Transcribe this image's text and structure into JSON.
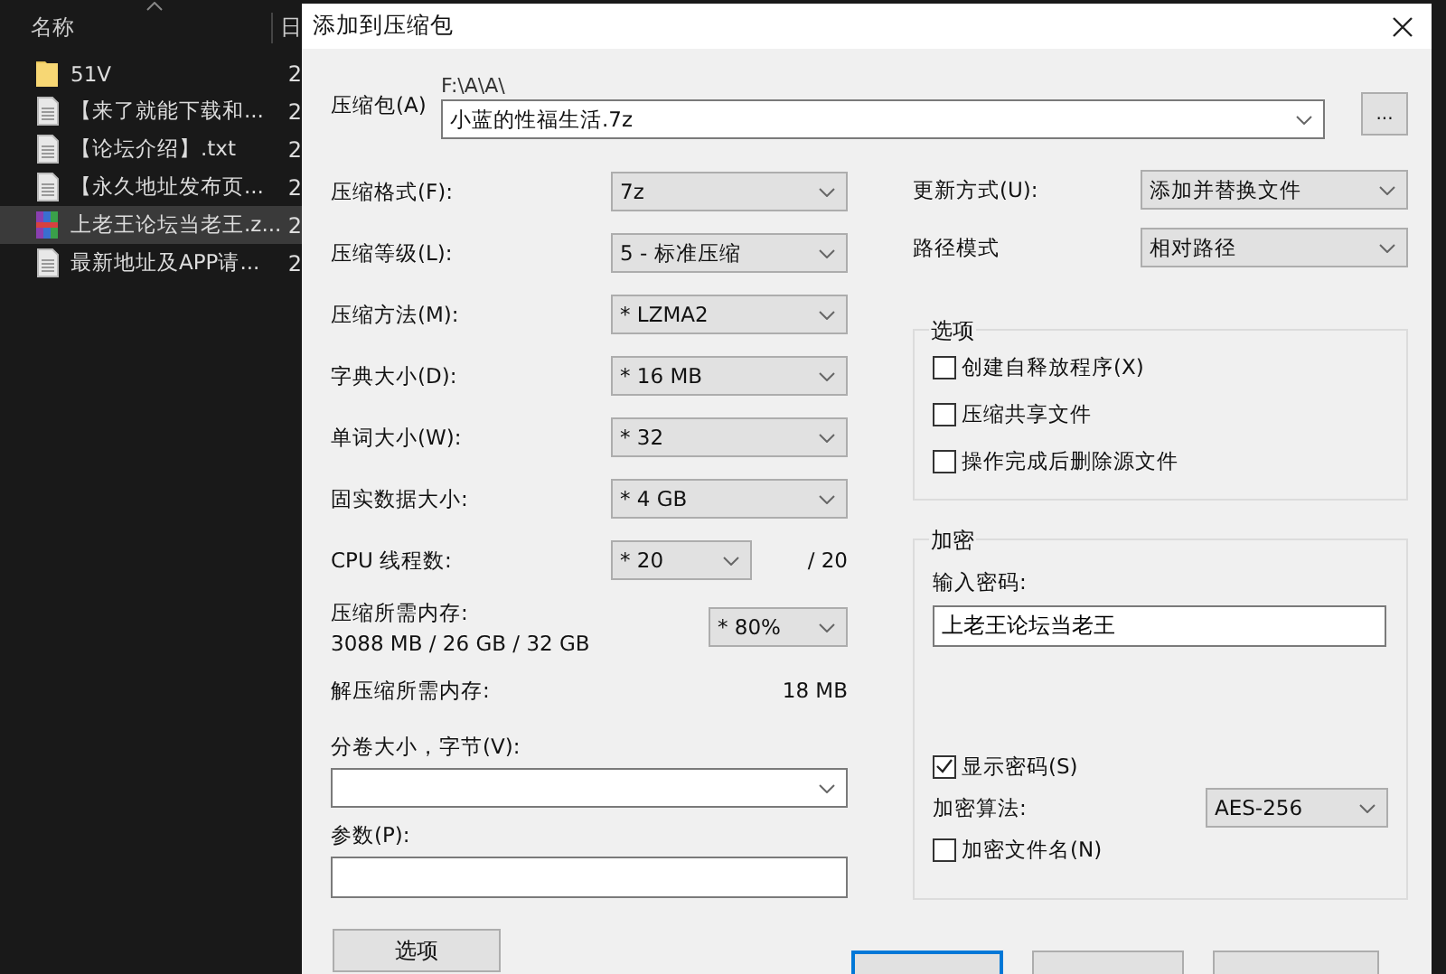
{
  "explorer": {
    "columns": [
      "名称",
      "日"
    ],
    "files": [
      {
        "name": "51V",
        "kind": "folder",
        "date": "2",
        "selected": false
      },
      {
        "name": "【来了就能下载和...",
        "kind": "text",
        "date": "2",
        "selected": false
      },
      {
        "name": "【论坛介绍】.txt",
        "kind": "text",
        "date": "2",
        "selected": false
      },
      {
        "name": "【永久地址发布页...",
        "kind": "text",
        "date": "2",
        "selected": false
      },
      {
        "name": "上老王论坛当老王.z...",
        "kind": "archive",
        "date": "2",
        "selected": true
      },
      {
        "name": "最新地址及APP请...",
        "kind": "text",
        "date": "2",
        "selected": false
      }
    ]
  },
  "dialog": {
    "title": "添加到压缩包",
    "archive": {
      "label": "压缩包(A)",
      "path": "F:\\A\\A\\",
      "value": "小蓝的性福生活.7z",
      "browse": "..."
    },
    "left_rows": [
      {
        "kind": "combo",
        "label": "压缩格式(F):",
        "value": "7z"
      },
      {
        "kind": "combo",
        "label": "压缩等级(L):",
        "value": "5 - 标准压缩"
      },
      {
        "kind": "combo",
        "label": "压缩方法(M):",
        "value": "* LZMA2"
      },
      {
        "kind": "combo",
        "label": "字典大小(D):",
        "value": "* 16 MB"
      },
      {
        "kind": "combo",
        "label": "单词大小(W):",
        "value": "* 32"
      },
      {
        "kind": "combo",
        "label": "固实数据大小:",
        "value": "* 4 GB"
      },
      {
        "kind": "threads",
        "label": "CPU 线程数:",
        "value": "* 20",
        "suffix": "/ 20"
      },
      {
        "kind": "memory",
        "label": "压缩所需内存:",
        "detail": "3088 MB / 26 GB / 32 GB",
        "value": "* 80%"
      },
      {
        "kind": "info",
        "label": "解压缩所需内存:",
        "value": "18 MB"
      }
    ],
    "volume": {
      "label": "分卷大小，字节(V):"
    },
    "params": {
      "label": "参数(P):"
    },
    "options_button": "选项",
    "update": {
      "label": "更新方式(U):",
      "value": "添加并替换文件"
    },
    "path_mode": {
      "label": "路径模式",
      "value": "相对路径"
    },
    "options_group": {
      "title": "选项",
      "checkboxes": [
        {
          "label": "创建自释放程序(X)",
          "checked": false
        },
        {
          "label": "压缩共享文件",
          "checked": false
        },
        {
          "label": "操作完成后删除源文件",
          "checked": false
        }
      ]
    },
    "encryption": {
      "title": "加密",
      "password_label": "输入密码:",
      "password": "上老王论坛当老王",
      "show_password": {
        "label": "显示密码(S)",
        "checked": true
      },
      "method_label": "加密算法:",
      "method": "AES-256",
      "encrypt_names": {
        "label": "加密文件名(N)",
        "checked": false
      }
    },
    "footer_buttons": [
      {
        "default": true
      },
      {
        "default": false
      },
      {
        "default": false
      }
    ]
  }
}
